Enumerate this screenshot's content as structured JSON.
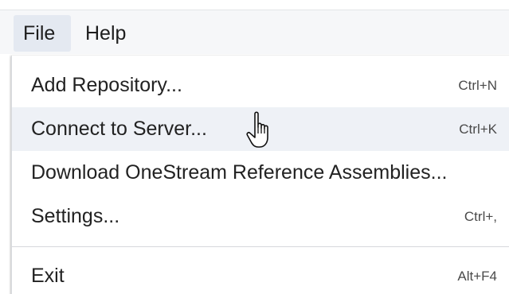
{
  "menubar": {
    "items": [
      {
        "label": "File"
      },
      {
        "label": "Help"
      }
    ]
  },
  "file_menu": {
    "items": [
      {
        "label": "Add Repository...",
        "shortcut": "Ctrl+N"
      },
      {
        "label": "Connect to Server...",
        "shortcut": "Ctrl+K"
      },
      {
        "label": "Download OneStream Reference Assemblies...",
        "shortcut": ""
      },
      {
        "label": "Settings...",
        "shortcut": "Ctrl+,"
      },
      {
        "label": "Exit",
        "shortcut": "Alt+F4"
      }
    ],
    "hovered_item": "Connect to Server..."
  },
  "cursor": {
    "icon": "hand-pointer-icon"
  },
  "colors": {
    "menubar_bg": "#f6f7f9",
    "active_menu_bg": "#e4e9f1",
    "hover_bg": "#eef1f6",
    "text": "#222222"
  }
}
